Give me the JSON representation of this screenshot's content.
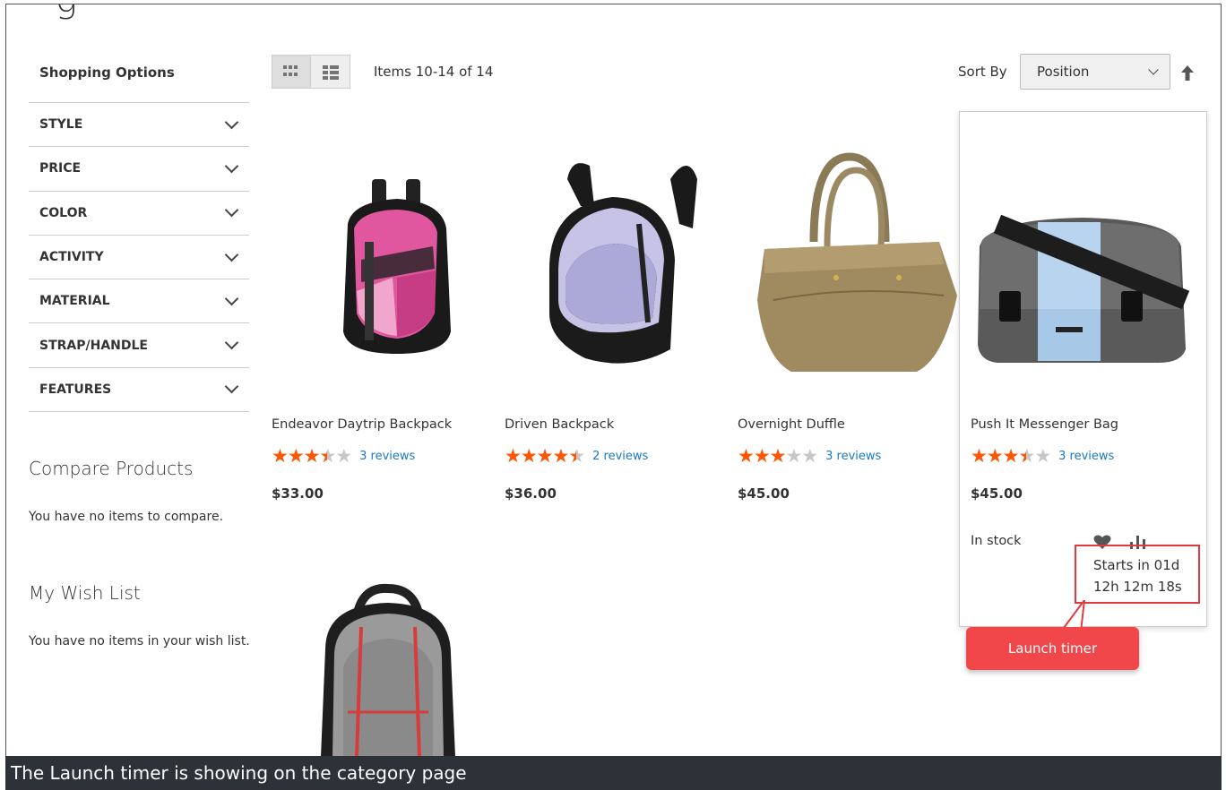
{
  "page": {
    "title_fragment": "g"
  },
  "sidebar": {
    "heading": "Shopping Options",
    "filters": [
      {
        "label": "STYLE"
      },
      {
        "label": "PRICE"
      },
      {
        "label": "COLOR"
      },
      {
        "label": "ACTIVITY"
      },
      {
        "label": "MATERIAL"
      },
      {
        "label": "STRAP/HANDLE"
      },
      {
        "label": "FEATURES"
      }
    ],
    "compare": {
      "title": "Compare Products",
      "text": "You have no items to compare."
    },
    "wishlist": {
      "title": "My Wish List",
      "text": "You have no items in your wish list."
    }
  },
  "toolbar": {
    "view_modes": [
      {
        "name": "grid",
        "icon": "grid-icon",
        "active": true
      },
      {
        "name": "list",
        "icon": "list-icon",
        "active": false
      }
    ],
    "amount": "Items 10-14 of 14",
    "sort_label": "Sort By",
    "sort_value": "Position",
    "sort_direction_icon": "arrow-up-icon"
  },
  "products": [
    {
      "name": "Endeavor Daytrip Backpack",
      "rating": 3.5,
      "reviews": "3 reviews",
      "price": "$33.00",
      "image": "pink-black-backpack"
    },
    {
      "name": "Driven Backpack",
      "rating": 4.5,
      "reviews": "2 reviews",
      "price": "$36.00",
      "image": "lavender-black-backpack"
    },
    {
      "name": "Overnight Duffle",
      "rating": 3,
      "reviews": "3 reviews",
      "price": "$45.00",
      "image": "tan-duffle-bag"
    },
    {
      "name": "Push It Messenger Bag",
      "rating": 3.5,
      "reviews": "3 reviews",
      "price": "$45.00",
      "image": "grey-blue-messenger-bag",
      "stock": "In stock",
      "timer_line1": "Starts in 01d",
      "timer_line2": "12h 12m 18s"
    },
    {
      "name": "",
      "image": "grey-red-backpack"
    }
  ],
  "card_actions": {
    "wishlist_icon": "heart-icon",
    "compare_icon": "bar-chart-icon"
  },
  "annotation": {
    "callout": "Launch timer"
  },
  "caption": "The Launch timer is showing on the category page",
  "colors": {
    "star": "#ff5501",
    "link": "#1979c3",
    "callout": "#f2474a",
    "highlight": "#e23a3a",
    "caption_bg": "#2c3238"
  }
}
